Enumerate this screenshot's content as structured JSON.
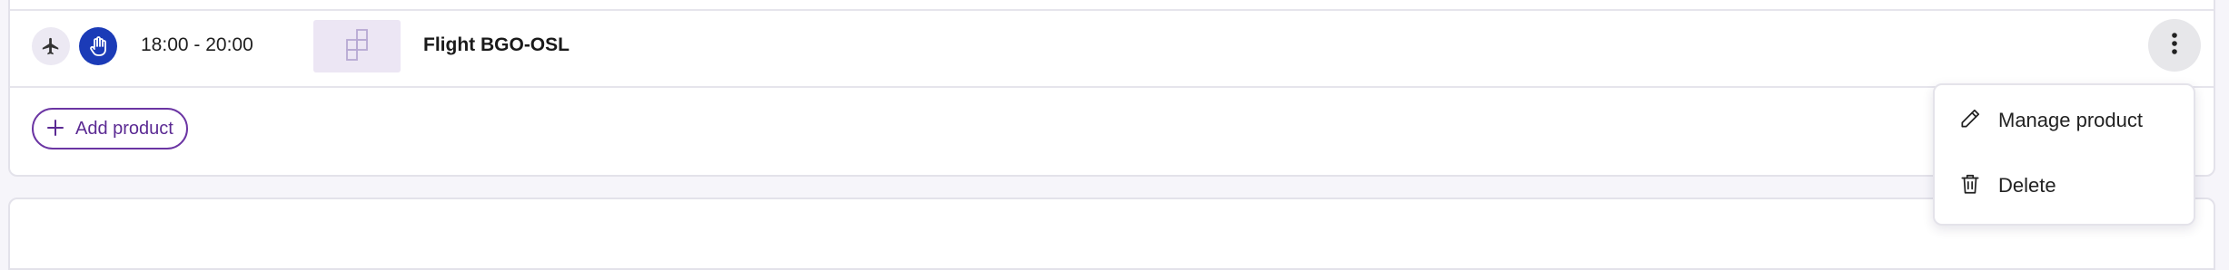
{
  "product_row": {
    "time_range": "18:00 - 20:00",
    "product_name": "Flight BGO-OSL",
    "icons": [
      "airplane-icon",
      "hand-stop-icon",
      "product-placeholder-icon",
      "more-vertical-icon"
    ]
  },
  "actions": {
    "add_product_label": "Add product",
    "add_icon": "plus-icon"
  },
  "context_menu": {
    "items": [
      {
        "label": "Manage product",
        "icon": "pencil-icon"
      },
      {
        "label": "Delete",
        "icon": "trash-icon"
      }
    ]
  },
  "colors": {
    "page_background": "#f6f5fa",
    "accent_purple": "#6b35a3",
    "hand_badge_blue": "#1b3bb7",
    "thumbnail_tint": "#ece6f4",
    "more_button_bg": "#e7e7ea"
  }
}
